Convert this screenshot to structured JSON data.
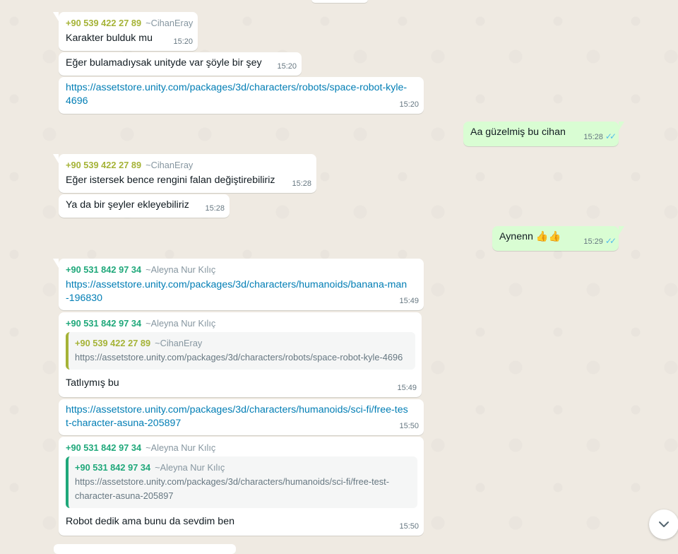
{
  "colors": {
    "sender_cihan": "#a5b337",
    "sender_aleyna": "#1fa87a",
    "link": "#027eb5",
    "outgoing_bubble": "#d9fdd3",
    "read_ticks": "#53bdeb"
  },
  "messages": [
    {
      "sender_phone": "+90 539 422 27 89",
      "sender_alias": "~CihanEray",
      "text": "Karakter bulduk mu",
      "time": "15:20"
    },
    {
      "text": "Eğer bulamadıysak unityde var şöyle bir şey",
      "time": "15:20"
    },
    {
      "link": "https://assetstore.unity.com/packages/3d/characters/robots/space-robot-kyle-4696",
      "time": "15:20"
    },
    {
      "text": "Aa güzelmiş bu cihan",
      "time": "15:28",
      "ticks": "✓✓"
    },
    {
      "sender_phone": "+90 539 422 27 89",
      "sender_alias": "~CihanEray",
      "text": "Eğer istersek bence rengini falan değiştirebiliriz",
      "time": "15:28"
    },
    {
      "text": "Ya da bir şeyler ekleyebiliriz",
      "time": "15:28"
    },
    {
      "text": "Aynenn 👍👍",
      "time": "15:29",
      "ticks": "✓✓"
    },
    {
      "sender_phone": "+90 531 842 97 34",
      "sender_alias": "~Aleyna Nur Kılıç",
      "link": "https://assetstore.unity.com/packages/3d/characters/humanoids/banana-man-196830",
      "time": "15:49"
    },
    {
      "sender_phone": "+90 531 842 97 34",
      "sender_alias": "~Aleyna Nur Kılıç",
      "quote": {
        "phone": "+90 539 422 27 89",
        "alias": "~CihanEray",
        "text": "https://assetstore.unity.com/packages/3d/characters/robots/space-robot-kyle-4696"
      },
      "text": "Tatlıymış bu",
      "time": "15:49"
    },
    {
      "link": "https://assetstore.unity.com/packages/3d/characters/humanoids/sci-fi/free-test-character-asuna-205897",
      "time": "15:50"
    },
    {
      "sender_phone": "+90 531 842 97 34",
      "sender_alias": "~Aleyna Nur Kılıç",
      "quote": {
        "phone": "+90 531 842 97 34",
        "alias": "~Aleyna Nur Kılıç",
        "text": "https://assetstore.unity.com/packages/3d/characters/humanoids/sci-fi/free-test-character-asuna-205897"
      },
      "text": "Robot dedik ama bunu da sevdim ben",
      "time": "15:50"
    }
  ],
  "scroll_button": {
    "icon": "chevron-down-icon"
  }
}
